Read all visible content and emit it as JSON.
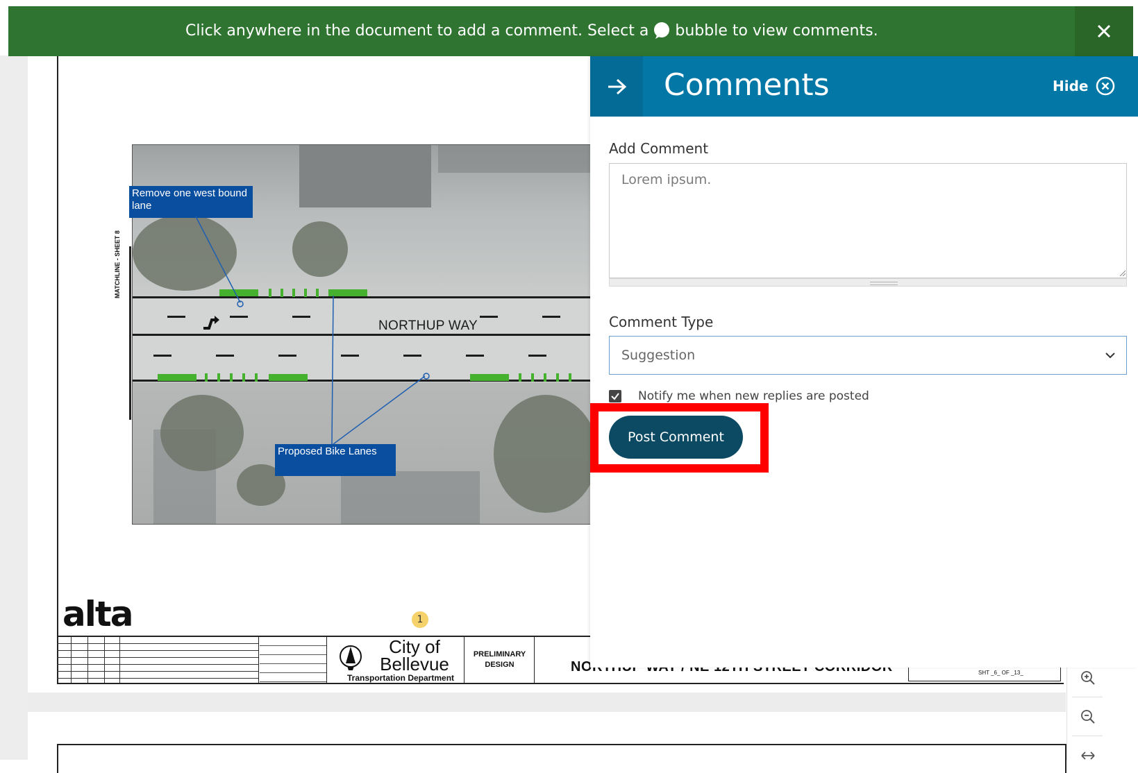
{
  "banner": {
    "text_before": "Click anywhere in the document to add a comment. Select a",
    "text_after": "bubble to view comments.",
    "close_icon": "close-icon"
  },
  "panel": {
    "title": "Comments",
    "hide_label": "Hide",
    "add_comment_label": "Add Comment",
    "comment_placeholder": "Lorem ipsum.",
    "comment_type_label": "Comment Type",
    "comment_type_value": "Suggestion",
    "notify_label": "Notify me when new replies are posted",
    "notify_checked": true,
    "post_button": "Post Comment",
    "highlight_color": "#ff0000"
  },
  "document": {
    "callout_1": "Remove one west bound lane",
    "callout_2": "Proposed Bike Lanes",
    "street_name": "NORTHUP WAY",
    "matchline": "MATCHLINE - SHEET 8",
    "logo": "alta",
    "comment_marker_count": "1",
    "city_name": "City of Bellevue",
    "city_department": "Transportation Department",
    "prelim": "PRELIMINARY DESIGN",
    "project_title": "NORTHUP WAY / NE 12TH STREET CORRIDOR",
    "sheet_label": "SHT _6_ OF _13_"
  },
  "colors": {
    "banner_bg": "#2f7430",
    "panel_header_bg": "#0378a6",
    "post_button_bg": "#0c4a63",
    "callout_bg": "#0a4ea0",
    "bike_lane_green": "#46b12f"
  },
  "toolbar": {
    "zoom_in_icon": "zoom-in-icon",
    "zoom_out_icon": "zoom-out-icon",
    "fit_width_icon": "fit-width-icon"
  }
}
